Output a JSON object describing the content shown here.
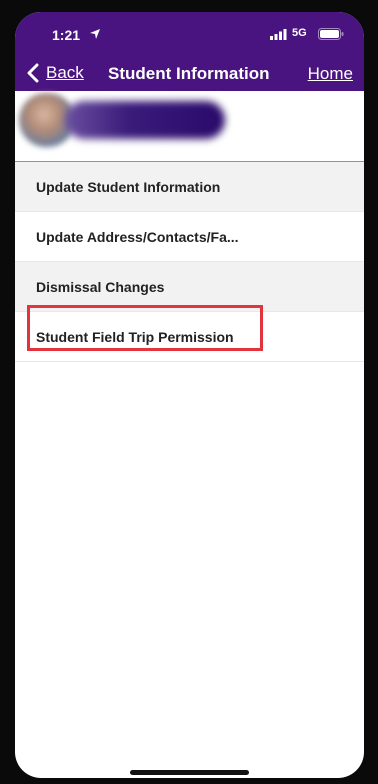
{
  "status_bar": {
    "time": "1:21",
    "network": "5G"
  },
  "nav": {
    "back_label": "Back",
    "title": "Student Information",
    "home_label": "Home"
  },
  "menu": {
    "items": [
      {
        "label": "Update Student Information"
      },
      {
        "label": "Update Address/Contacts/Fa..."
      },
      {
        "label": "Dismissal Changes"
      },
      {
        "label": "Student Field Trip Permission"
      }
    ]
  },
  "colors": {
    "header_bg": "#4a1480",
    "highlight_border": "#e3343e",
    "row_shaded": "#f2f2f2"
  },
  "icons": {
    "location": "location-arrow-icon",
    "signal": "signal-bars-icon",
    "battery": "battery-icon",
    "back": "chevron-left-icon"
  }
}
